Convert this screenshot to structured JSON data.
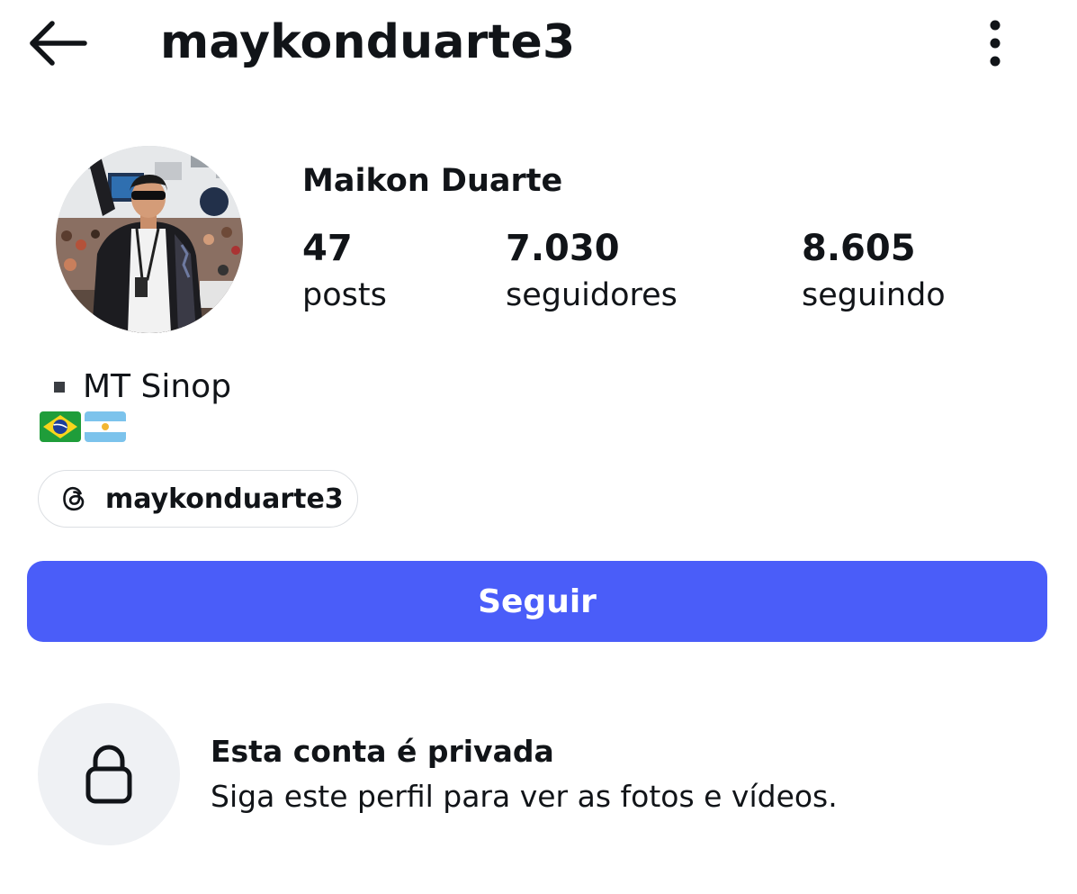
{
  "header": {
    "username": "maykonduarte3",
    "back_icon": "arrow-left-icon",
    "more_icon": "vertical-ellipsis-icon"
  },
  "profile": {
    "full_name": "Maikon Duarte",
    "avatar_icon": "profile-photo",
    "stats": [
      {
        "value": "47",
        "label": "posts"
      },
      {
        "value": "7.030",
        "label": "seguidores"
      },
      {
        "value": "8.605",
        "label": "seguindo"
      }
    ]
  },
  "bio": {
    "line1": "MT Sinop",
    "flags": [
      "brazil-flag-icon",
      "argentina-flag-icon"
    ]
  },
  "threads_link": {
    "label": "maykonduarte3",
    "icon": "threads-icon"
  },
  "follow_button": {
    "label": "Seguir",
    "color": "#4a5df9"
  },
  "private_notice": {
    "title": "Esta conta é privada",
    "subtitle": "Siga este perfil para ver as fotos e vídeos.",
    "icon": "lock-icon"
  }
}
